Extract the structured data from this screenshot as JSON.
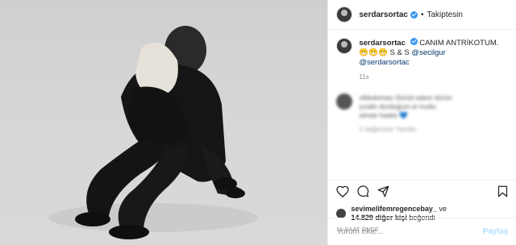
{
  "header": {
    "username": "serdarsortac",
    "dot": "•",
    "follow_status": "Takiptesin"
  },
  "caption": {
    "username": "serdarsortac",
    "text": "CANIM ANTRİKOTUM.",
    "line2": "😬😬😬 S & S",
    "mention1": "@secilgur",
    "mention2": "@serdarsortac",
    "time": "11s"
  },
  "blurred_comment": {
    "line1": "sibkalomas Sürüd adem dürün",
    "line2": "çıraklı durduğum ei mutlu",
    "line3": "olmalı hadisi 💙",
    "meta": "1 beğenme   Yanıtla"
  },
  "likes": {
    "liker": "sevimelifemregencebay_",
    "and": "ve",
    "count": "14.829 diğer kişi",
    "suffix": "beğendi",
    "ago": "11 SAAT ÖNCE"
  },
  "add_comment": {
    "placeholder": "Yorum ekle...",
    "post_label": "Paylaş"
  },
  "colors": {
    "verified": "#3897f0",
    "text": "#262626",
    "muted": "#8e8e8e",
    "post_disabled": "#b2dffc"
  },
  "icons": [
    "heart-icon",
    "comment-icon",
    "share-icon",
    "bookmark-icon",
    "verified-icon"
  ]
}
